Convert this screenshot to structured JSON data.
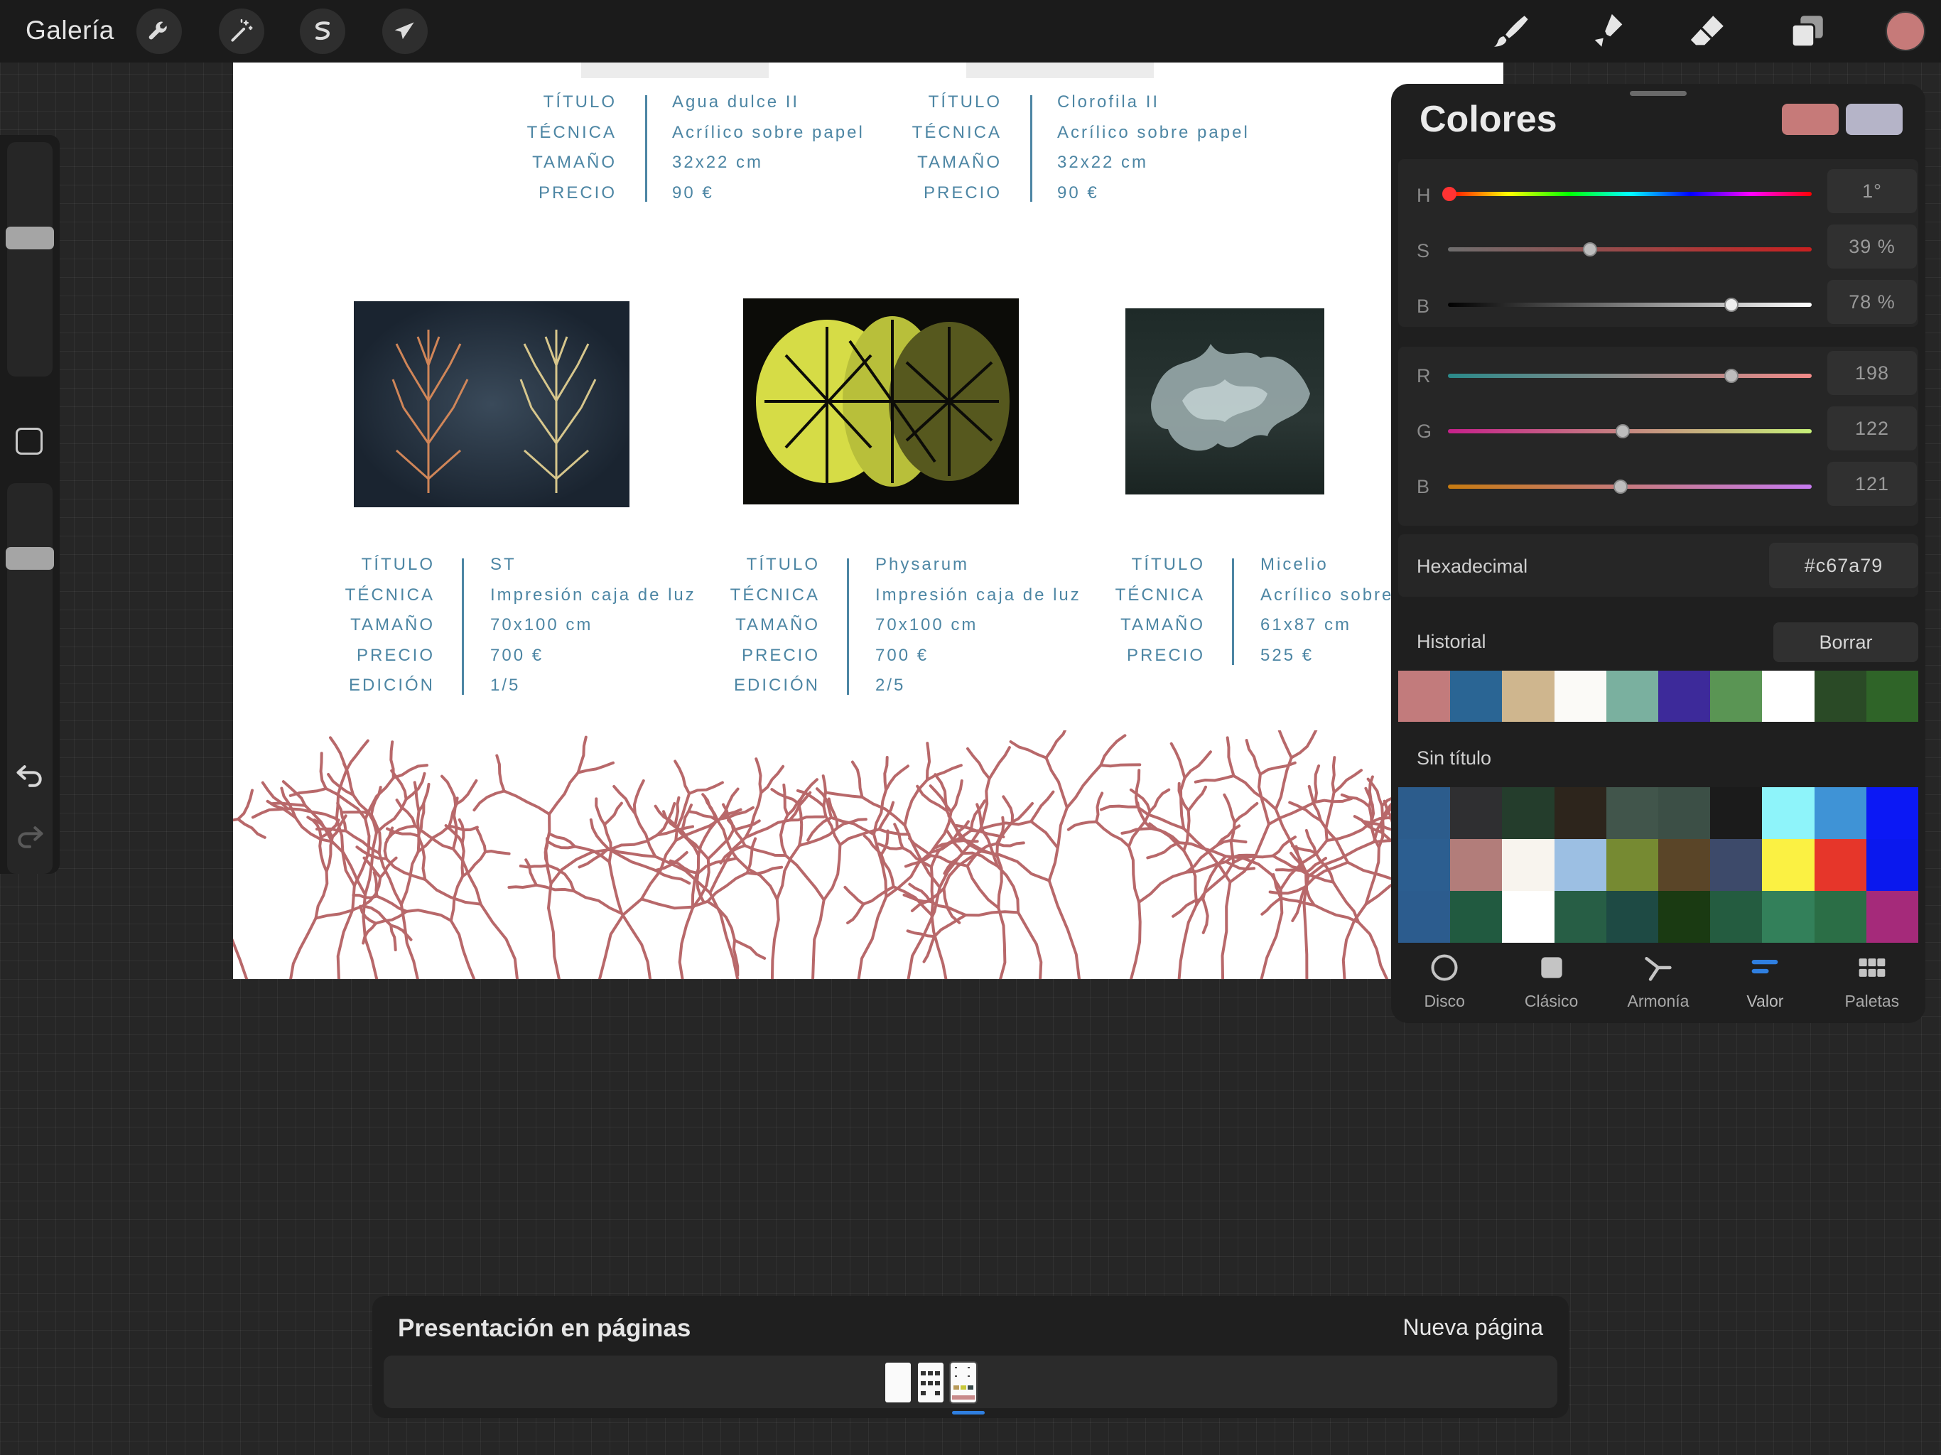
{
  "topbar": {
    "gallery_label": "Galería",
    "left_tools": [
      "wrench-icon",
      "magic-wand-icon",
      "selection-icon",
      "transform-arrow-icon"
    ],
    "right_tools": [
      "brush-icon",
      "smudge-icon",
      "eraser-icon",
      "layers-icon"
    ],
    "current_color": "#c67a79"
  },
  "sidebar": {
    "brush_size_level": 0.6,
    "opacity_level": 0.2,
    "icons": [
      "modify-square-icon",
      "undo-icon",
      "redo-icon"
    ]
  },
  "canvas": {
    "top_cards": [
      {
        "labels": [
          "TÍTULO",
          "TÉCNICA",
          "TAMAÑO",
          "PRECIO"
        ],
        "values": [
          "Agua dulce II",
          "Acrílico sobre papel",
          "32x22 cm",
          "90 €"
        ]
      },
      {
        "labels": [
          "TÍTULO",
          "TÉCNICA",
          "TAMAÑO",
          "PRECIO"
        ],
        "values": [
          "Clorofila II",
          "Acrílico sobre papel",
          "32x22 cm",
          "90 €"
        ]
      }
    ],
    "bottom_cards": [
      {
        "labels": [
          "TÍTULO",
          "TÉCNICA",
          "TAMAÑO",
          "PRECIO",
          "EDICIÓN"
        ],
        "values": [
          "ST",
          "Impresión caja de luz",
          "70x100 cm",
          "700 €",
          "1/5"
        ]
      },
      {
        "labels": [
          "TÍTULO",
          "TÉCNICA",
          "TAMAÑO",
          "PRECIO",
          "EDICIÓN"
        ],
        "values": [
          "Physarum",
          "Impresión caja de luz",
          "70x100 cm",
          "700 €",
          "2/5"
        ]
      },
      {
        "labels": [
          "TÍTULO",
          "TÉCNICA",
          "TAMAÑO",
          "PRECIO"
        ],
        "values": [
          "Micelio",
          "Acrílico sobre",
          "61x87 cm",
          "525 €"
        ]
      }
    ],
    "text_color": "#4d86a4",
    "coral_color": "#b8686a"
  },
  "colors_panel": {
    "title": "Colores",
    "primary_swatch": "#c67a79",
    "secondary_swatch": "#b5b4c8",
    "hsb": [
      {
        "label": "H",
        "value": "1°",
        "level": 0.003
      },
      {
        "label": "S",
        "value": "39 %",
        "level": 0.39
      },
      {
        "label": "B",
        "value": "78 %",
        "level": 0.78
      }
    ],
    "rgb": [
      {
        "label": "R",
        "value": "198",
        "level": 0.78
      },
      {
        "label": "G",
        "value": "122",
        "level": 0.48
      },
      {
        "label": "B",
        "value": "121",
        "level": 0.475
      }
    ],
    "hex_label": "Hexadecimal",
    "hex_value": "#c67a79",
    "history_label": "Historial",
    "clear_label": "Borrar",
    "history": [
      "#c27b7c",
      "#2a6594",
      "#cfb68e",
      "#fbfaf7",
      "#7ab09f",
      "#3d2a9a",
      "#5a9554",
      "#ffffff",
      "#2a4a26",
      "#2f6428"
    ],
    "palette_label": "Sin título",
    "palette": [
      "#2c5c8c",
      "#2f2f31",
      "#243d2c",
      "#2d251c",
      "#41554b",
      "#3c4f46",
      "#1b1b1b",
      "#8ef4fa",
      "#3f93d6",
      "#0b18f5",
      "#2c5e90",
      "#b27d7a",
      "#f8f4ee",
      "#9cbfe3",
      "#768a32",
      "#5a4528",
      "#3d4a6a",
      "#fbf143",
      "#e6362a",
      "#0a18ee",
      "#2c5c8e",
      "#215a40",
      "#ffffff",
      "#275e45",
      "#1e4a44",
      "#1a3a12",
      "#245c40",
      "#33805a",
      "#2b6e46",
      "#a52a7a"
    ],
    "modes": [
      {
        "label": "Disco",
        "icon": "disc-icon"
      },
      {
        "label": "Clásico",
        "icon": "classic-square-icon"
      },
      {
        "label": "Armonía",
        "icon": "harmony-icon"
      },
      {
        "label": "Valor",
        "icon": "value-sliders-icon",
        "active": true
      },
      {
        "label": "Paletas",
        "icon": "palettes-grid-icon"
      }
    ]
  },
  "pages": {
    "title": "Presentación en páginas",
    "new_page_label": "Nueva página"
  }
}
